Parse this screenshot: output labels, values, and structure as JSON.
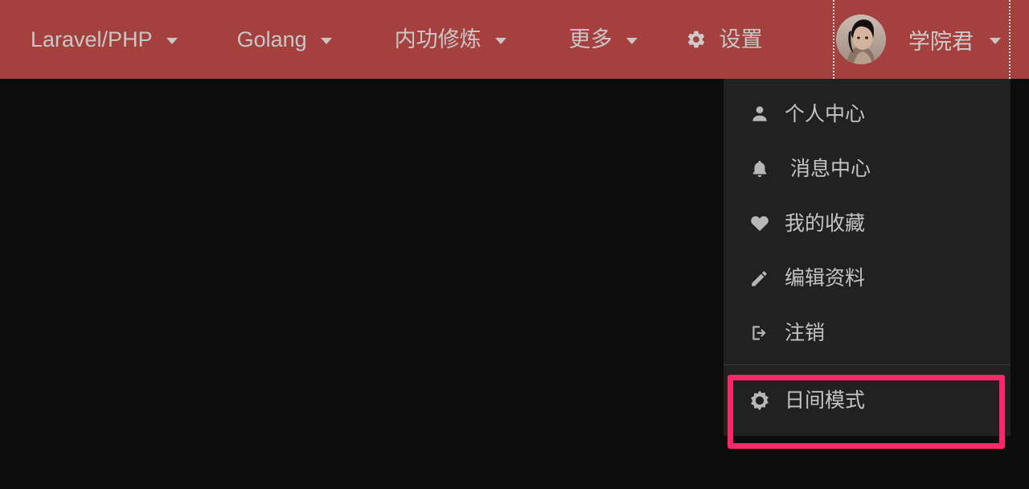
{
  "colors": {
    "navbar_bg": "#a4413f",
    "page_bg": "#0c0c0c",
    "dropdown_bg": "#212121",
    "text": "#c9c6c6",
    "highlight": "#f9286a",
    "divider": "#3a3a3a"
  },
  "navbar": {
    "items": [
      {
        "label": "Laravel/PHP",
        "caret": true,
        "icon": null
      },
      {
        "label": "Golang",
        "caret": true,
        "icon": null
      },
      {
        "label": "内功修炼",
        "caret": true,
        "icon": null
      },
      {
        "label": "更多",
        "caret": true,
        "icon": null
      },
      {
        "label": "设置",
        "caret": false,
        "icon": "gear-icon"
      }
    ],
    "user": {
      "name": "学院君",
      "avatar_alt": "用户头像",
      "caret": true,
      "focused": true
    }
  },
  "dropdown": {
    "open": true,
    "items": [
      {
        "label": "个人中心",
        "icon": "person-icon"
      },
      {
        "label": " 消息中心",
        "icon": "bell-icon"
      },
      {
        "label": "我的收藏",
        "icon": "heart-icon"
      },
      {
        "label": "编辑资料",
        "icon": "pencil-icon"
      },
      {
        "label": "注销",
        "icon": "logout-icon"
      }
    ],
    "footer": {
      "label": "日间模式",
      "icon": "brightness-icon",
      "highlighted": true
    }
  }
}
